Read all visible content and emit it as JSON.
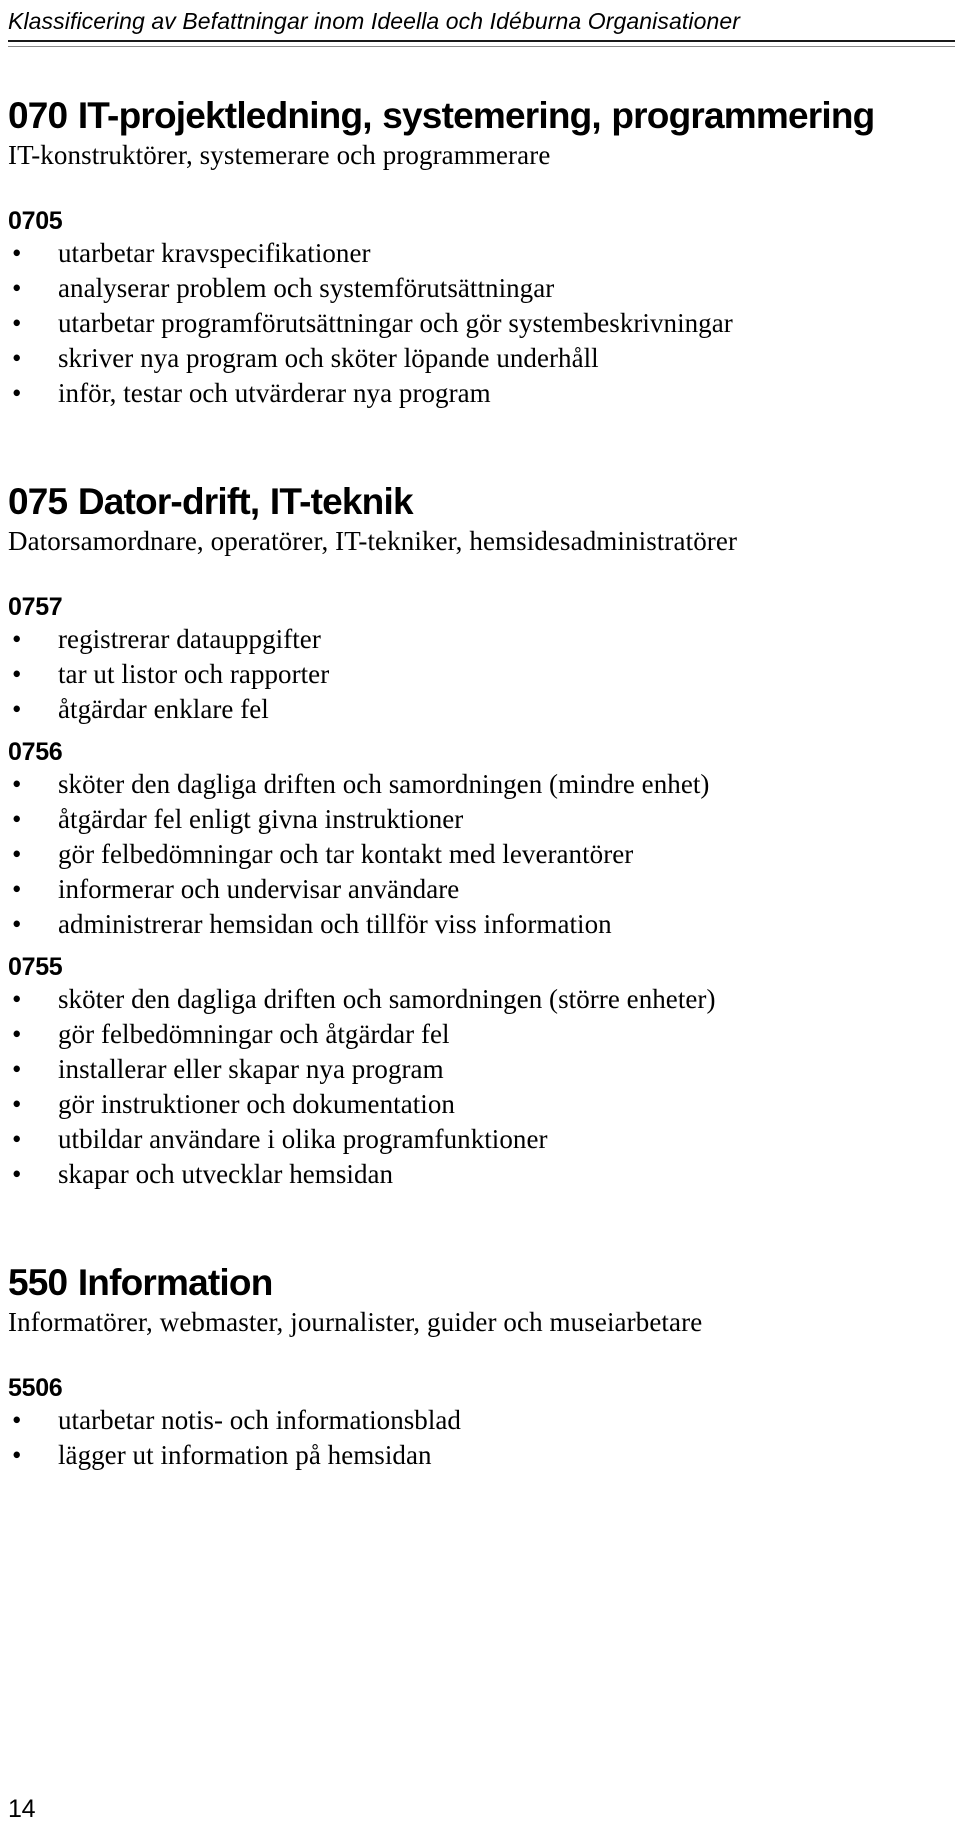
{
  "header": {
    "running_title": "Klassificering av Befattningar inom Ideella och Idéburna Organisationer"
  },
  "groups": [
    {
      "heading": "070 IT-projektledning, systemering, programmering",
      "subtitle": "IT-konstruktörer, systemerare och programmerare",
      "codes": [
        {
          "code": "0705",
          "duties": [
            "utarbetar kravspecifikationer",
            "analyserar problem och systemförutsättningar",
            "utarbetar programförutsättningar och gör systembeskrivningar",
            "skriver nya program och sköter löpande underhåll",
            "inför, testar och utvärderar nya program"
          ]
        }
      ]
    },
    {
      "heading": "075 Dator-drift, IT-teknik",
      "subtitle": "Datorsamordnare, operatörer, IT-tekniker, hemsidesadministratörer",
      "codes": [
        {
          "code": "0757",
          "duties": [
            "registrerar datauppgifter",
            "tar ut listor och rapporter",
            "åtgärdar enklare fel"
          ]
        },
        {
          "code": "0756",
          "duties": [
            "sköter den dagliga driften och samordningen (mindre enhet)",
            "åtgärdar fel enligt givna instruktioner",
            "gör felbedömningar och tar kontakt med leverantörer",
            "informerar och undervisar användare",
            "administrerar hemsidan och tillför viss information"
          ]
        },
        {
          "code": "0755",
          "duties": [
            "sköter den dagliga driften och samordningen (större enheter)",
            "gör felbedömningar och åtgärdar fel",
            "installerar eller skapar nya program",
            "gör instruktioner och dokumentation",
            "utbildar användare i olika programfunktioner",
            "skapar och utvecklar hemsidan"
          ]
        }
      ]
    },
    {
      "heading": "550 Information",
      "subtitle": "Informatörer, webmaster, journalister, guider och museiarbetare",
      "codes": [
        {
          "code": "5506",
          "duties": [
            "utarbetar notis- och informationsblad",
            "lägger ut information på hemsidan"
          ]
        }
      ]
    }
  ],
  "footer": {
    "page_number": "14"
  },
  "glyphs": {
    "bullet": "•"
  }
}
